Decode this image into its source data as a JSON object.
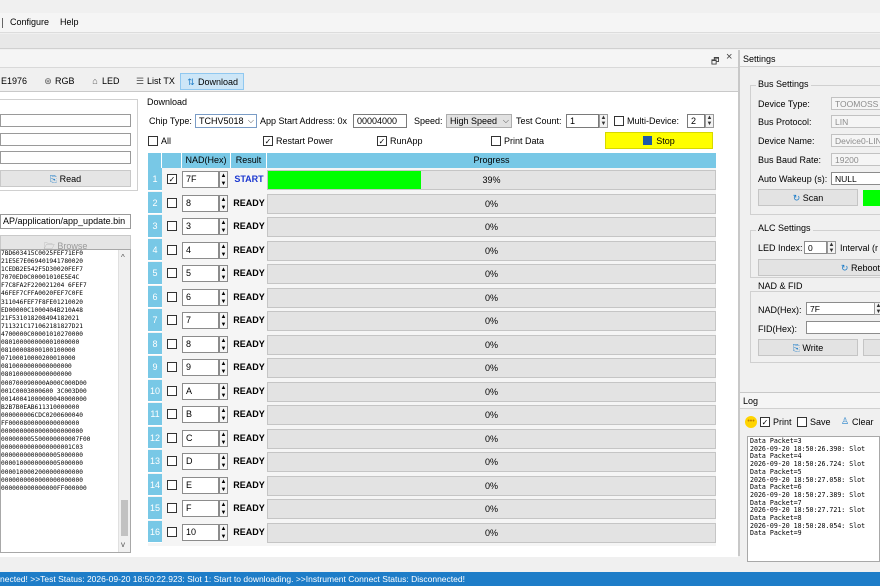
{
  "menu": {
    "configure": "Configure",
    "help": "Help"
  },
  "dock": {
    "pin_glyph": "🗗",
    "close_glyph": "×"
  },
  "tabs": [
    {
      "label": "E1976",
      "icon": ""
    },
    {
      "label": "RGB",
      "icon": "rgb-icon"
    },
    {
      "label": "LED",
      "icon": "led-icon"
    },
    {
      "label": "List TX",
      "icon": "list-icon"
    },
    {
      "label": "Download",
      "icon": "download-icon",
      "active": true
    }
  ],
  "left": {
    "read_label": "Read",
    "path_value": "AP/application/app_update.bin",
    "browse_label": "Browse",
    "hex_lines": [
      "7BD603415C0025FEF71EF0",
      "21E5E7E069401941780020",
      "1CEDB2E542F5D30020FEF7",
      "7070ED0C00001010E5E4C",
      "F7C8FA2F220021204 6FEF7",
      "46FEF7CFFA0020FEF7C0FE",
      "311046FEF7F8FE01210020",
      "ED00000C1000404B210A48",
      "21F531018208494182021",
      "711321C171062181827D21",
      "4700000C00001010270000",
      "080100000000001000000",
      "08100008000100100000",
      "07100010000200010000",
      "0810000000000000000",
      "0801000000000000000",
      "000700090000A000C000D00",
      "001C0003000600 3C003D00",
      "00140041000000040000000",
      "B2B7B0EAB611310000000",
      "000000006CDC0200600040",
      "FF0000800000000000000",
      "0000000000000000000000",
      "000000005500000000007F00",
      "0000000000000000001C03",
      "0000000000000005000000",
      "0000100000000005000000",
      "0000100002000000000000",
      "0000000000000000000000",
      "000000000000000FF000000"
    ]
  },
  "download": {
    "group_label": "Download",
    "chip_type_label": "Chip Type:",
    "chip_type_value": "TCHV5018",
    "app_start_label": "App Start Address: 0x",
    "app_start_value": "00004000",
    "speed_label": "Speed:",
    "speed_value": "High Speed",
    "test_count_label": "Test Count:",
    "test_count_value": "1",
    "multi_device_label": "Multi-Device:",
    "multi_device_value": "2",
    "multi_device_checked": false,
    "all_label": "All",
    "restart_power_label": "Restart Power",
    "restart_power_checked": true,
    "runapp_label": "RunApp",
    "runapp_checked": true,
    "print_data_label": "Print Data",
    "print_data_checked": false,
    "stop_label": "Stop",
    "columns": {
      "nad": "NAD(Hex)",
      "result": "Result",
      "progress": "Progress"
    },
    "rows": [
      {
        "num": "1",
        "checked": true,
        "nad": "7F",
        "result": "START",
        "progress": 39,
        "progress_text": "39%"
      },
      {
        "num": "2",
        "checked": false,
        "nad": "8",
        "result": "READY",
        "progress": 0,
        "progress_text": "0%"
      },
      {
        "num": "3",
        "checked": false,
        "nad": "3",
        "result": "READY",
        "progress": 0,
        "progress_text": "0%"
      },
      {
        "num": "4",
        "checked": false,
        "nad": "4",
        "result": "READY",
        "progress": 0,
        "progress_text": "0%"
      },
      {
        "num": "5",
        "checked": false,
        "nad": "5",
        "result": "READY",
        "progress": 0,
        "progress_text": "0%"
      },
      {
        "num": "6",
        "checked": false,
        "nad": "6",
        "result": "READY",
        "progress": 0,
        "progress_text": "0%"
      },
      {
        "num": "7",
        "checked": false,
        "nad": "7",
        "result": "READY",
        "progress": 0,
        "progress_text": "0%"
      },
      {
        "num": "8",
        "checked": false,
        "nad": "8",
        "result": "READY",
        "progress": 0,
        "progress_text": "0%"
      },
      {
        "num": "9",
        "checked": false,
        "nad": "9",
        "result": "READY",
        "progress": 0,
        "progress_text": "0%"
      },
      {
        "num": "10",
        "checked": false,
        "nad": "A",
        "result": "READY",
        "progress": 0,
        "progress_text": "0%"
      },
      {
        "num": "11",
        "checked": false,
        "nad": "B",
        "result": "READY",
        "progress": 0,
        "progress_text": "0%"
      },
      {
        "num": "12",
        "checked": false,
        "nad": "C",
        "result": "READY",
        "progress": 0,
        "progress_text": "0%"
      },
      {
        "num": "13",
        "checked": false,
        "nad": "D",
        "result": "READY",
        "progress": 0,
        "progress_text": "0%"
      },
      {
        "num": "14",
        "checked": false,
        "nad": "E",
        "result": "READY",
        "progress": 0,
        "progress_text": "0%"
      },
      {
        "num": "15",
        "checked": false,
        "nad": "F",
        "result": "READY",
        "progress": 0,
        "progress_text": "0%"
      },
      {
        "num": "16",
        "checked": false,
        "nad": "10",
        "result": "READY",
        "progress": 0,
        "progress_text": "0%"
      }
    ]
  },
  "settings": {
    "title": "Settings",
    "bus_settings": "Bus Settings",
    "device_type_label": "Device Type:",
    "device_type_value": "TOOMOSS",
    "bus_protocol_label": "Bus Protocol:",
    "bus_protocol_value": "LIN",
    "device_name_label": "Device Name:",
    "device_name_value": "Device0-LIN",
    "bus_baud_label": "Bus Baud Rate:",
    "bus_baud_value": "19200",
    "auto_wakeup_label": "Auto Wakeup (s):",
    "auto_wakeup_value": "NULL",
    "scan_label": "Scan",
    "alc_settings": "ALC Settings",
    "led_index_label": "LED Index:",
    "led_index_value": "0",
    "interval_label": "Interval (r",
    "reboot_label": "Reboot",
    "nad_fid": "NAD & FID",
    "nad_label": "NAD(Hex):",
    "nad_value": "7F",
    "fid_label": "FID(Hex):",
    "fid_value": "",
    "write_label": "Write"
  },
  "log": {
    "title": "Log",
    "print_label": "Print",
    "print_checked": true,
    "save_label": "Save",
    "save_checked": false,
    "clear_label": "Clear",
    "lines": [
      "Data Packet=3",
      "2026-09-20 18:50:26.390: Slot",
      "Data Packet=4",
      "2026-09-20 18:50:26.724: Slot",
      "Data Packet=5",
      "2026-09-20 18:50:27.058: Slot",
      "Data Packet=6",
      "2026-09-20 18:50:27.389: Slot",
      "Data Packet=7",
      "2026-09-20 18:50:27.721: Slot",
      "Data Packet=8",
      "2026-09-20 18:50:28.054: Slot",
      "Data Packet=9"
    ]
  },
  "status": {
    "text": "nected! >>Test Status: 2026-09-20 18:50:22.923: Slot 1: Start to downloading. >>Instrument Connect Status: Disconnected!"
  },
  "colors": {
    "accent": "#1e7dc8",
    "grid_header": "#78c8e6",
    "progress_fill": "#00ff00",
    "stop_button": "#ffff00",
    "scan_indicator": "#00ff00"
  }
}
